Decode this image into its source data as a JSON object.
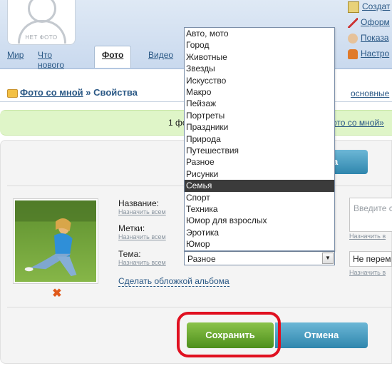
{
  "header": {
    "avatar_label": "НЕТ ФОТО",
    "tabs": [
      {
        "label": "Мир"
      },
      {
        "label": "Что нового"
      },
      {
        "label": "Фото"
      },
      {
        "label": "Видео"
      }
    ],
    "right_links": [
      {
        "label": "Создат",
        "icon": "create-icon"
      },
      {
        "label": "Оформ",
        "icon": "brush-icon"
      },
      {
        "label": "Показа",
        "icon": "show-icon"
      },
      {
        "label": "Настро",
        "icon": "settings-user-icon"
      }
    ]
  },
  "breadcrumb": {
    "album": "Фото со мной",
    "separator": " » ",
    "current": "Свойства",
    "right_link": "основные"
  },
  "notice": {
    "text": "1 фо",
    "link": "ото со мной»"
  },
  "top_button_label": "а",
  "form": {
    "name_label": "Название:",
    "tags_label": "Метки:",
    "theme_label": "Тема:",
    "assign_all": "Назначить всем",
    "description_placeholder": "Введите с",
    "assign_right": "Назначить в",
    "theme_value": "Разное",
    "right_select_value": "Не перем",
    "cover_link": "Сделать обложкой альбома"
  },
  "dropdown": {
    "options": [
      "Авто, мото",
      "Город",
      "Животные",
      "Звезды",
      "Искусство",
      "Макро",
      "Пейзаж",
      "Портреты",
      "Праздники",
      "Природа",
      "Путешествия",
      "Разное",
      "Рисунки",
      "Семья",
      "Спорт",
      "Техника",
      "Юмор для взрослых",
      "Эротика",
      "Юмор"
    ],
    "highlighted": "Семья"
  },
  "buttons": {
    "save": "Сохранить",
    "cancel": "Отмена"
  },
  "colors": {
    "save": "#5fa22a",
    "cancel": "#3a90b8",
    "highlight_ring": "#e01020",
    "notice_bg": "#dff5c8"
  }
}
